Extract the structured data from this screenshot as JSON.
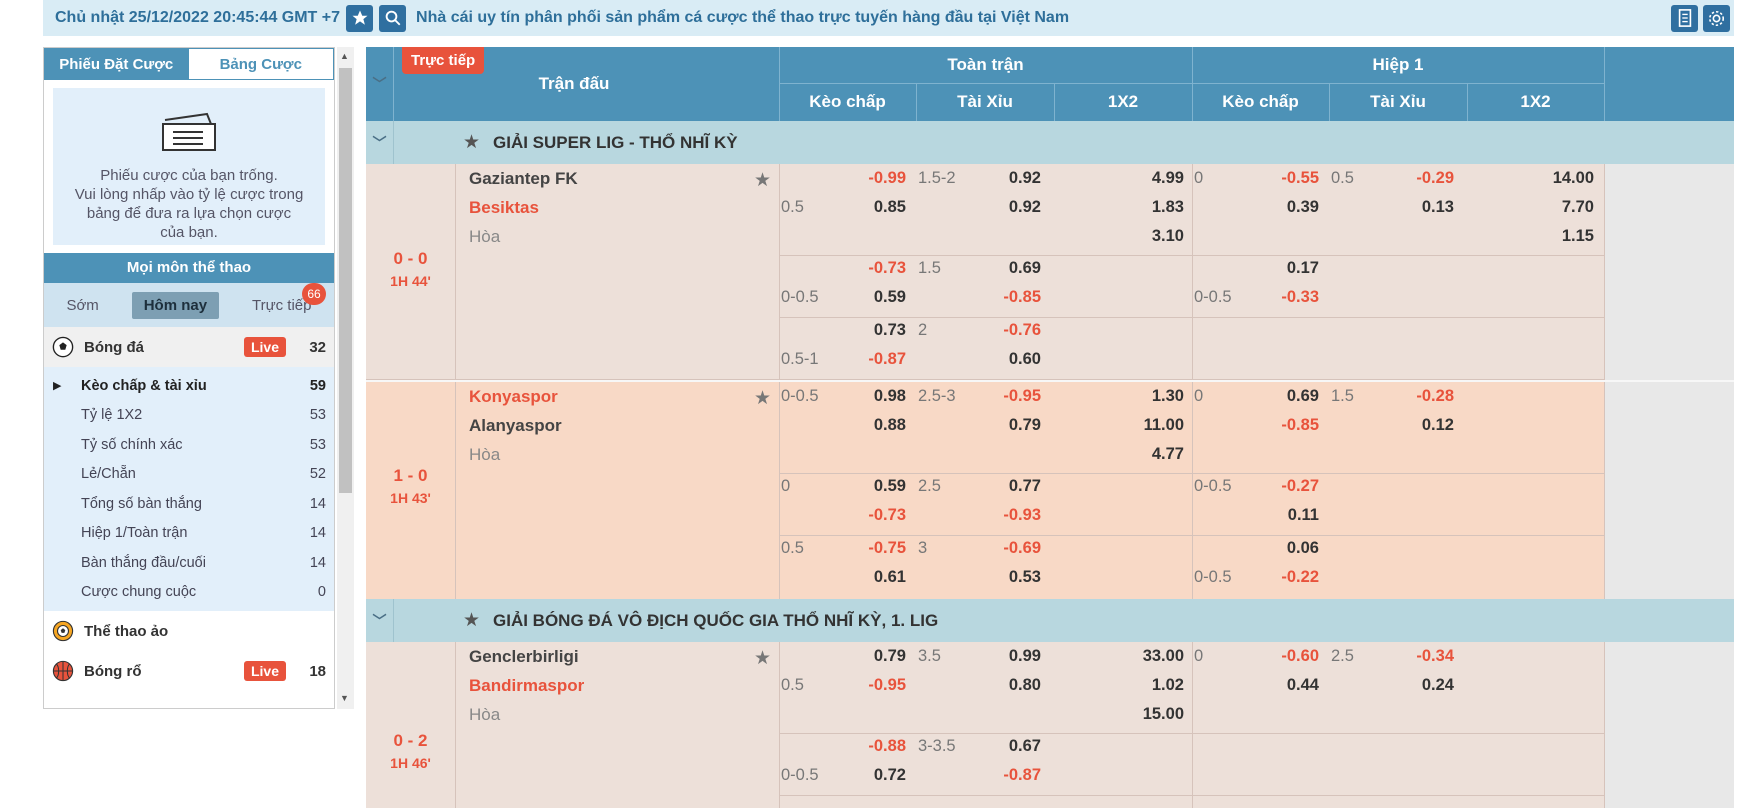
{
  "topbar": {
    "datetime": "Chủ nhật 25/12/2022 20:45:44 GMT +7",
    "marquee": "Nhà cái uy tín phân phối sản phẩm cá cược thể thao trực tuyến hàng đầu tại Việt Nam"
  },
  "sidebar": {
    "tabs": [
      "Phiếu Đặt Cược",
      "Bảng Cược"
    ],
    "slip_lines": [
      "Phiếu cược của bạn trống.",
      "Vui lòng nhấp vào tỷ lệ cược trong",
      "bảng để đưa ra lựa chọn cược",
      "của bạn."
    ],
    "sports_heading": "Mọi môn thể thao",
    "time_filters": [
      "Sớm",
      "Hôm nay",
      "Trực tiếp"
    ],
    "live_count": "66",
    "football": {
      "label": "Bóng đá",
      "live": "Live",
      "count": "32"
    },
    "sub_items": [
      {
        "label": "Kèo chấp & tài xỉu",
        "count": "59"
      },
      {
        "label": "Tỷ lệ 1X2",
        "count": "53"
      },
      {
        "label": "Tỷ số chính xác",
        "count": "53"
      },
      {
        "label": "Lẻ/Chẵn",
        "count": "52"
      },
      {
        "label": "Tổng số bàn thắng",
        "count": "14"
      },
      {
        "label": "Hiệp 1/Toàn trận",
        "count": "14"
      },
      {
        "label": "Bàn thắng đầu/cuối",
        "count": "14"
      },
      {
        "label": "Cược chung cuộc",
        "count": "0"
      }
    ],
    "virtual": {
      "label": "Thể thao ảo"
    },
    "basketball": {
      "label": "Bóng rổ",
      "live": "Live",
      "count": "18"
    }
  },
  "table": {
    "live_tag": "Trực tiếp",
    "match_col": "Trận đấu",
    "full_time": "Toàn trận",
    "first_half": "Hiệp 1",
    "cols": [
      "Kèo chấp",
      "Tài Xỉu",
      "1X2",
      "Kèo chấp",
      "Tài Xỉu",
      "1X2"
    ],
    "leagues": [
      "GIẢI SUPER LIG - THỔ NHĨ KỲ",
      "GIẢI BÓNG ĐÁ VÔ ĐỊCH QUỐC GIA THỔ NHĨ KỲ, 1. LIG"
    ],
    "draw_label": "Hòa",
    "m1": {
      "score": "0 - 0",
      "time": "1H 44'",
      "home": "Gaziantep FK",
      "away": "Besiktas",
      "r1": {
        "ft_h2": "0.5",
        "ft_o1": "-0.99",
        "ft_o2": "0.85",
        "ft_ou": "1.5-2",
        "ft_t1": "0.92",
        "ft_t2": "0.92",
        "x1": "4.99",
        "x2": "1.83",
        "x3": "3.10",
        "h1_h1": "0",
        "h1_o1": "-0.55",
        "h1_o2": "0.39",
        "h1_ou": "0.5",
        "h1_t1": "-0.29",
        "h1_t2": "0.13",
        "hx1": "14.00",
        "hx2": "7.70",
        "hx3": "1.15"
      },
      "r2": {
        "ft_h2": "0-0.5",
        "ft_o1": "-0.73",
        "ft_o2": "0.59",
        "ft_ou": "1.5",
        "ft_t1": "0.69",
        "ft_t2": "-0.85",
        "h1_h2": "0-0.5",
        "h1_o1": "0.17",
        "h1_o2": "-0.33"
      },
      "r3": {
        "ft_h2": "0.5-1",
        "ft_o1": "0.73",
        "ft_o2": "-0.87",
        "ft_ou": "2",
        "ft_t1": "-0.76",
        "ft_t2": "0.60"
      }
    },
    "m2": {
      "score": "1 - 0",
      "time": "1H 43'",
      "home": "Konyaspor",
      "away": "Alanyaspor",
      "r1": {
        "ft_h1": "0-0.5",
        "ft_o1": "0.98",
        "ft_o2": "0.88",
        "ft_ou": "2.5-3",
        "ft_t1": "-0.95",
        "ft_t2": "0.79",
        "x1": "1.30",
        "x2": "11.00",
        "x3": "4.77",
        "h1_h1": "0",
        "h1_o1": "0.69",
        "h1_o2": "-0.85",
        "h1_ou": "1.5",
        "h1_t1": "-0.28",
        "h1_t2": "0.12"
      },
      "r2": {
        "ft_h1": "0",
        "ft_o1": "0.59",
        "ft_o2": "-0.73",
        "ft_ou": "2.5",
        "ft_t1": "0.77",
        "ft_t2": "-0.93",
        "h1_h1": "0-0.5",
        "h1_o1": "-0.27",
        "h1_o2": "0.11"
      },
      "r3": {
        "ft_h1": "0.5",
        "ft_o1": "-0.75",
        "ft_o2": "0.61",
        "ft_ou": "3",
        "ft_t1": "-0.69",
        "ft_t2": "0.53",
        "h1_h2": "0-0.5",
        "h1_o1": "0.06",
        "h1_o2": "-0.22"
      }
    },
    "m3": {
      "score": "0 - 2",
      "time": "1H 46'",
      "home": "Genclerbirligi",
      "away": "Bandirmaspor",
      "r1": {
        "ft_h2": "0.5",
        "ft_o1": "0.79",
        "ft_o2": "-0.95",
        "ft_ou": "3.5",
        "ft_t1": "0.99",
        "ft_t2": "0.80",
        "x1": "33.00",
        "x2": "1.02",
        "x3": "15.00",
        "h1_h1": "0",
        "h1_o1": "-0.60",
        "h1_o2": "0.44",
        "h1_ou": "2.5",
        "h1_t1": "-0.34",
        "h1_t2": "0.24"
      },
      "r2": {
        "ft_h2": "0-0.5",
        "ft_o1": "-0.88",
        "ft_o2": "0.72",
        "ft_ou": "3-3.5",
        "ft_t1": "0.67",
        "ft_t2": "-0.87"
      }
    }
  }
}
